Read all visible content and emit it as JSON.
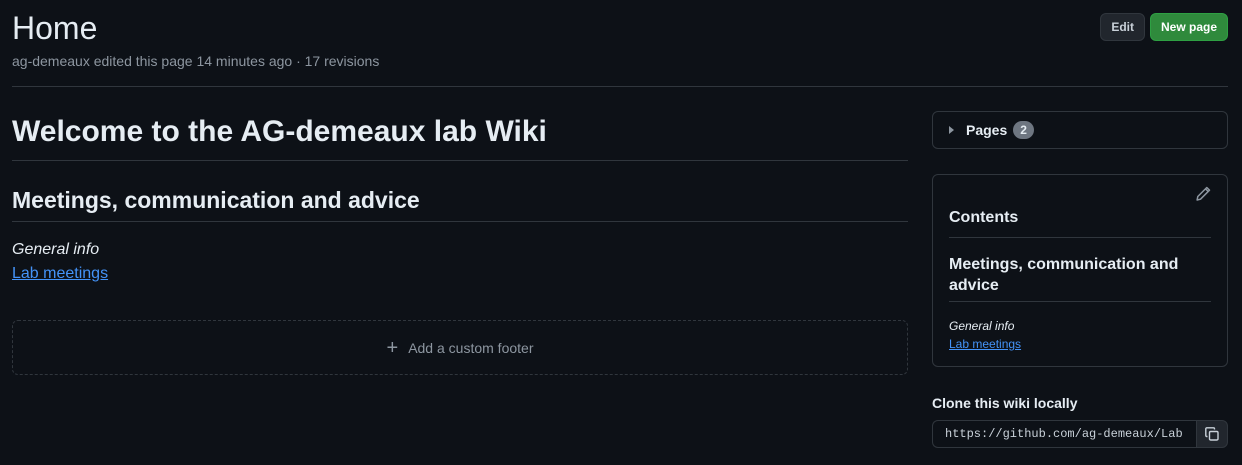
{
  "header": {
    "title": "Home",
    "meta": "ag-demeaux edited this page 14 minutes ago · 17 revisions",
    "edit_label": "Edit",
    "new_page_label": "New page"
  },
  "main": {
    "h1": "Welcome to the AG-demeaux lab Wiki",
    "h2": "Meetings, communication and advice",
    "general_info": "General info",
    "link": "Lab meetings",
    "footer_label": "Add a custom footer"
  },
  "sidebar": {
    "pages_label": "Pages",
    "pages_count": "2",
    "contents_title": "Contents",
    "contents_h2": "Meetings, communication and advice",
    "contents_info": "General info",
    "contents_link": "Lab meetings",
    "clone_label": "Clone this wiki locally",
    "clone_url": "https://github.com/ag-demeaux/Lab"
  },
  "icons": {
    "footer": "plus-icon",
    "pages": "triangle-right-icon",
    "contents_edit": "pencil-icon",
    "clone": "copy-icon"
  },
  "colors": {
    "background": "#0d1117",
    "link": "#4493f8",
    "primary_button": "#2f8a3c",
    "border": "#30363d"
  }
}
